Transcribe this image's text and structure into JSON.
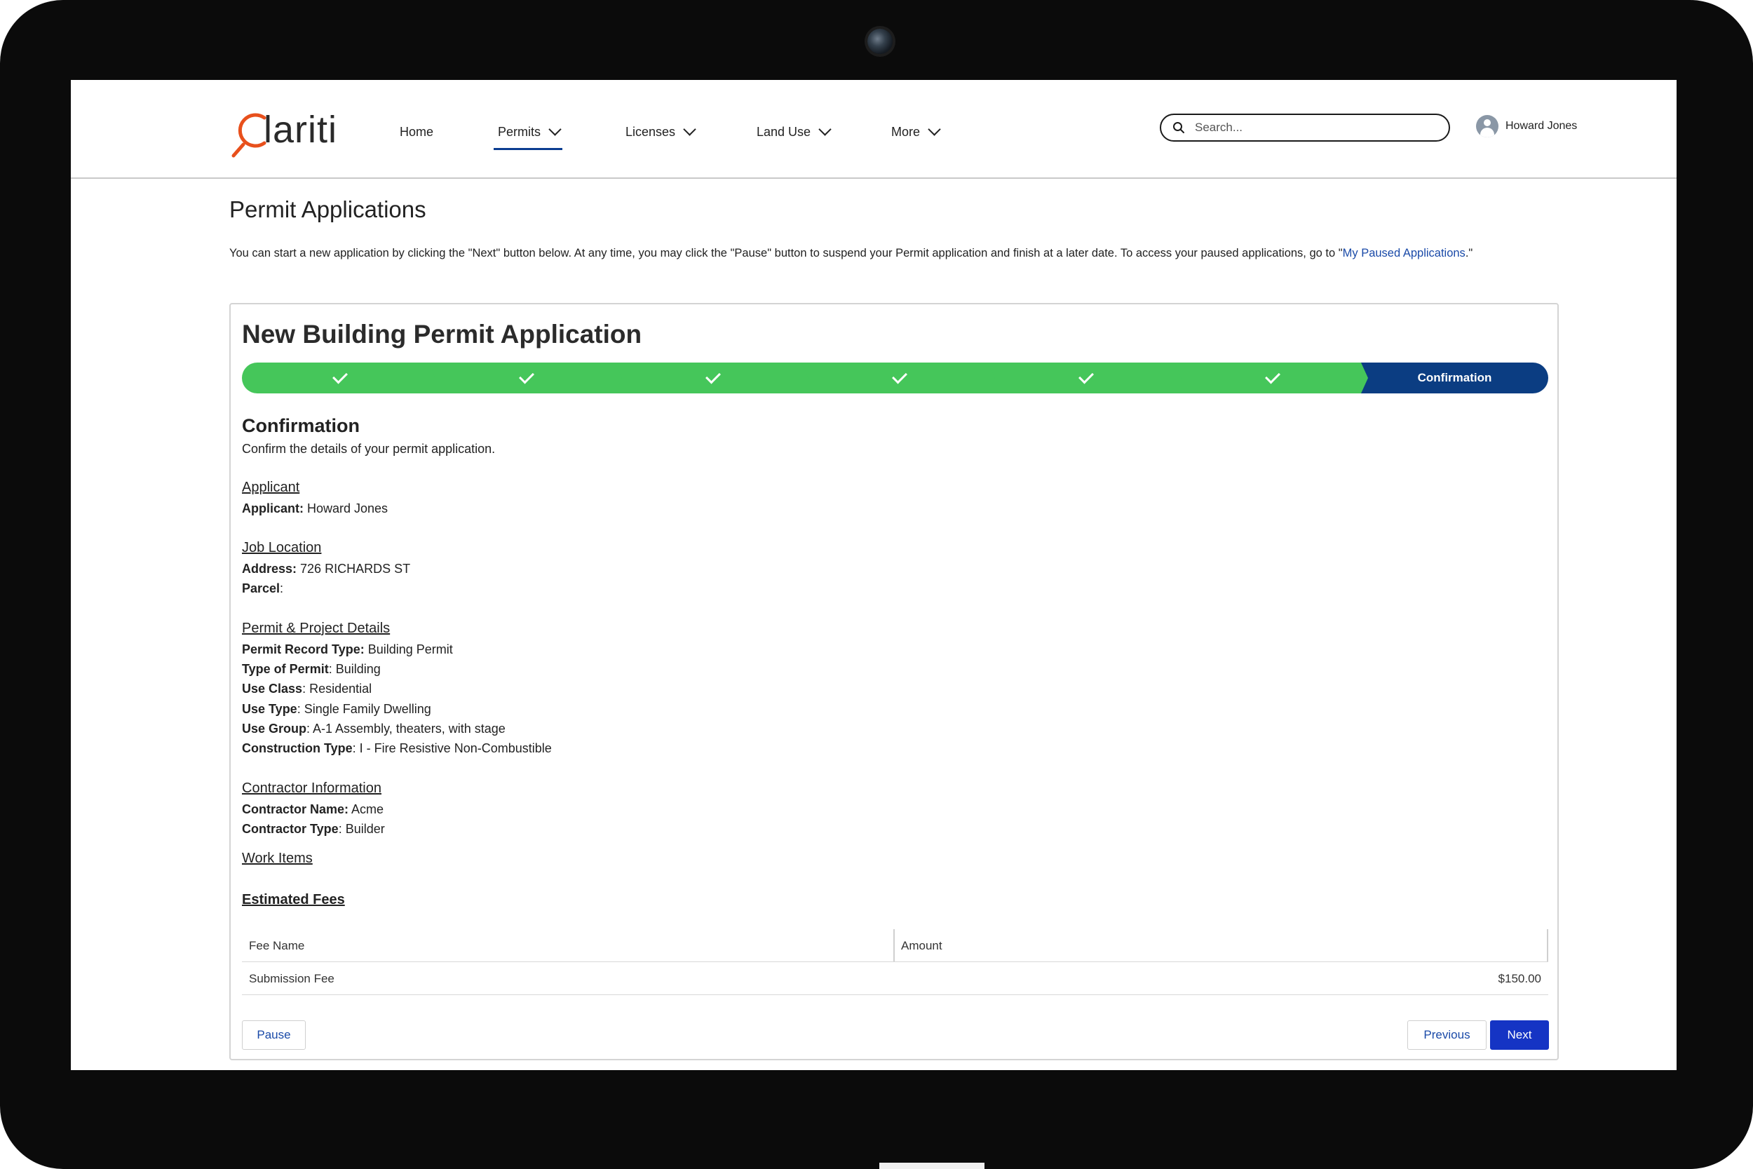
{
  "brand": {
    "logo_text": "lariti",
    "logo_full": "Clariti"
  },
  "nav": {
    "items": [
      {
        "label": "Home",
        "dropdown": false
      },
      {
        "label": "Permits",
        "dropdown": true,
        "active": true
      },
      {
        "label": "Licenses",
        "dropdown": true
      },
      {
        "label": "Land Use",
        "dropdown": true
      },
      {
        "label": "More",
        "dropdown": true
      }
    ]
  },
  "search": {
    "placeholder": "Search..."
  },
  "user": {
    "name": "Howard Jones"
  },
  "page": {
    "title": "Permit Applications",
    "intro_text": "You can start a new application by clicking the \"Next\" button below. At any time, you may click the \"Pause\" button to suspend your Permit application and finish at a later date. To access your paused applications, go to \"",
    "intro_link": "My Paused Applications",
    "intro_end": ".\""
  },
  "application": {
    "title": "New Building Permit Application",
    "steps": [
      {
        "status": "complete"
      },
      {
        "status": "complete"
      },
      {
        "status": "complete"
      },
      {
        "status": "complete"
      },
      {
        "status": "complete"
      },
      {
        "status": "complete"
      },
      {
        "status": "current",
        "label": "Confirmation"
      }
    ],
    "section_title": "Confirmation",
    "section_desc": "Confirm the details of your permit application.",
    "applicant": {
      "heading": "Applicant",
      "applicant_label": "Applicant:",
      "applicant_value": " Howard Jones"
    },
    "job_location": {
      "heading": "Job Location",
      "address_label": "Address:",
      "address_value": " 726 RICHARDS ST",
      "parcel_label": "Parcel",
      "parcel_value": ":"
    },
    "permit_details": {
      "heading": "Permit & Project Details",
      "record_type_label": "Permit Record Type:",
      "record_type_value": " Building Permit",
      "type_label": "Type of Permit",
      "type_value": ": Building",
      "use_class_label": "Use Class",
      "use_class_value": ": Residential",
      "use_type_label": "Use Type",
      "use_type_value": ": Single Family Dwelling",
      "use_group_label": "Use Group",
      "use_group_value": ": A-1 Assembly, theaters, with stage",
      "construction_label": "Construction Type",
      "construction_value": ": I - Fire Resistive Non-Combustible"
    },
    "contractor": {
      "heading": "Contractor Information",
      "name_label": "Contractor Name:",
      "name_value": " Acme",
      "type_label": "Contractor Type",
      "type_value": ": Builder"
    },
    "work_items_heading": "Work Items",
    "fees": {
      "heading": "Estimated Fees",
      "columns": [
        "Fee Name",
        "Amount"
      ],
      "rows": [
        {
          "name": "Submission Fee",
          "amount": "$150.00"
        }
      ]
    },
    "buttons": {
      "pause": "Pause",
      "previous": "Previous",
      "next": "Next"
    }
  },
  "colors": {
    "step_complete": "#45c65a",
    "step_current": "#0b3d82",
    "primary_button": "#1534c4",
    "link": "#1a4aa8",
    "logo_accent": "#e8501c"
  }
}
